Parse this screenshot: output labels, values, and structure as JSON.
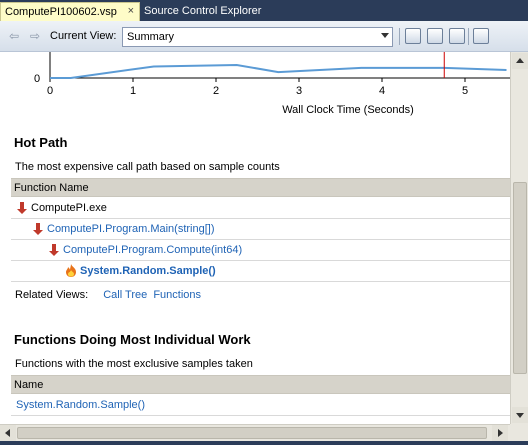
{
  "tabs": [
    {
      "label": "ComputePI100602.vsp",
      "close": "×",
      "active": true
    },
    {
      "label": "Source Control Explorer",
      "active": false
    }
  ],
  "toolbar": {
    "current_view_label": "Current View:",
    "current_view_value": "Summary",
    "icons": [
      "filter-icon",
      "export-icon",
      "compare-icon",
      "save-icon"
    ]
  },
  "chart_data": {
    "type": "line",
    "xlabel": "Wall Clock Time (Seconds)",
    "x_ticks": [
      "0",
      "1",
      "2",
      "3",
      "4",
      "5"
    ],
    "y_ticks": [
      "0"
    ],
    "xlim": [
      0,
      5.5
    ],
    "x": [
      0,
      0.25,
      1.25,
      2.25,
      2.75,
      3.75,
      4.75,
      5.5
    ],
    "y": [
      0,
      0,
      0.55,
      0.62,
      0.28,
      0.48,
      0.48,
      0.38
    ],
    "marker_x": 4.75,
    "colors": {
      "line": "#5b9bd5",
      "marker": "#cc0000"
    }
  },
  "hot_path": {
    "title": "Hot Path",
    "description": "The most expensive call path based on sample counts",
    "column": "Function Name",
    "rows": [
      {
        "label": "ComputePI.exe",
        "icon": "hot-arrow-icon",
        "link": false,
        "bold": false
      },
      {
        "label": "ComputePI.Program.Main(string[])",
        "icon": "hot-arrow-icon",
        "link": true,
        "bold": false
      },
      {
        "label": "ComputePI.Program.Compute(int64)",
        "icon": "hot-arrow-icon",
        "link": true,
        "bold": false
      },
      {
        "label": "System.Random.Sample()",
        "icon": "flame-icon",
        "link": true,
        "bold": true
      }
    ],
    "related_label": "Related Views:",
    "related_links": [
      "Call Tree",
      "Functions"
    ]
  },
  "individual_work": {
    "title": "Functions Doing Most Individual Work",
    "description": "Functions with the most exclusive samples taken",
    "column": "Name",
    "rows": [
      "System.Random.Sample()"
    ]
  }
}
